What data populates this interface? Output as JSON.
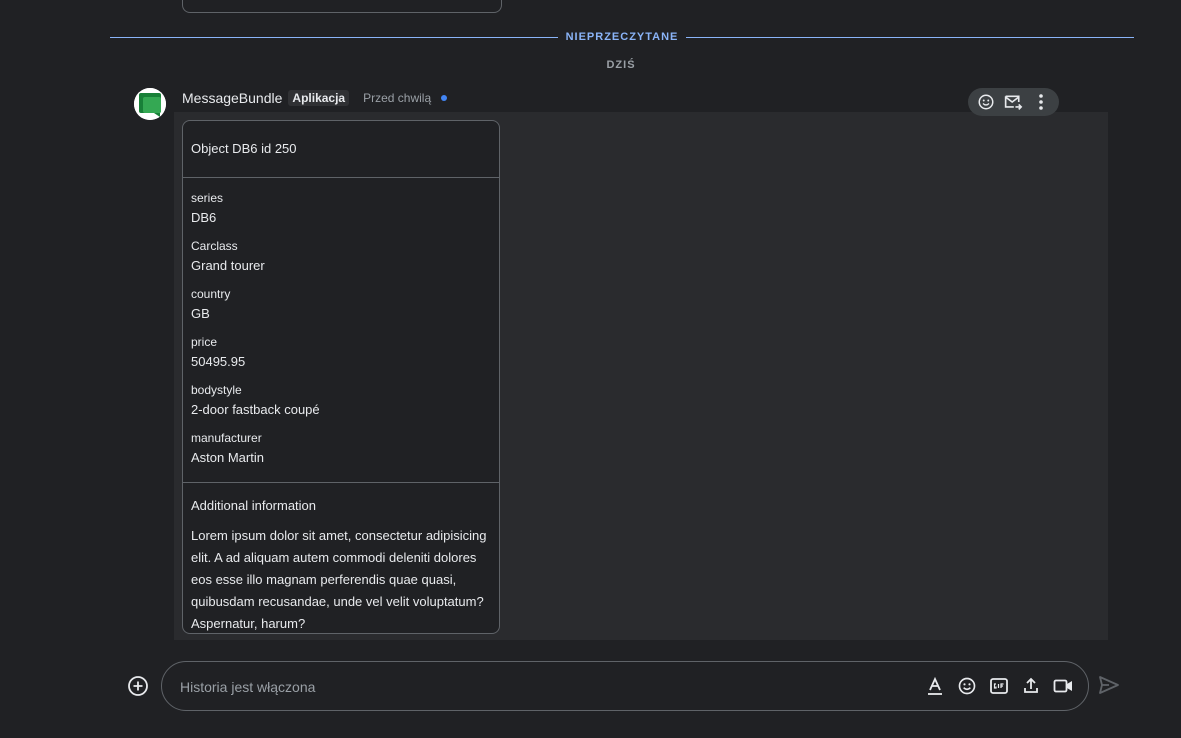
{
  "dividers": {
    "unread_label": "NIEPRZECZYTANE",
    "day_label": "DZIŚ"
  },
  "message": {
    "sender": "MessageBundle",
    "badge": "Aplikacja",
    "time": "Przed chwilą",
    "accent_color": "#4285f4"
  },
  "card": {
    "header": "Object DB6 id 250",
    "fields": [
      {
        "label": "series",
        "value": "DB6"
      },
      {
        "label": "Carclass",
        "value": "Grand tourer"
      },
      {
        "label": "country",
        "value": "GB"
      },
      {
        "label": "price",
        "value": "50495.95"
      },
      {
        "label": "bodystyle",
        "value": "2-door fastback coupé"
      },
      {
        "label": "manufacturer",
        "value": "Aston Martin"
      }
    ],
    "info_title": "Additional information",
    "info_body": "Lorem ipsum dolor sit amet, consectetur adipisicing elit. A ad aliquam autem commodi deleniti dolores eos esse illo magnam perferendis quae quasi, quibusdam recusandae, unde vel velit voluptatum? Aspernatur, harum?"
  },
  "toolbar": {
    "icons": [
      "emoji-icon",
      "forward-to-inbox-icon",
      "more-vert-icon"
    ]
  },
  "composer": {
    "placeholder": "Historia jest włączona",
    "icons": [
      "format-text-icon",
      "emoji-icon",
      "gif-icon",
      "upload-icon",
      "video-icon",
      "add-icon",
      "send-icon"
    ]
  }
}
